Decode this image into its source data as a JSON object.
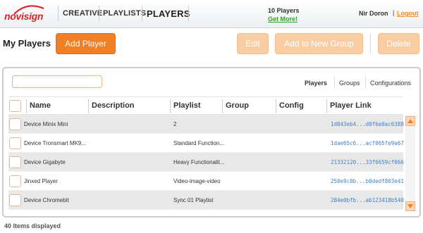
{
  "brand": {
    "logo_text": "novisign",
    "accent": "#f07f26",
    "logo_color": "#d8232a"
  },
  "nav": {
    "creative": "CREATIVE",
    "playlists": "PLAYLISTS",
    "players": "PLAYERS"
  },
  "account": {
    "players_count": "10 Players",
    "get_more": "Get More!",
    "user_name": "Nir Doron",
    "separator": "|",
    "logout": "Logout"
  },
  "actions": {
    "title": "My Players",
    "add_player": "Add Player",
    "edit": "Edit",
    "add_to_group": "Add to New Group",
    "delete": "Delete"
  },
  "search": {
    "placeholder": "",
    "value": ""
  },
  "subtabs": {
    "players": "Players",
    "groups": "Groups",
    "configurations": "Configurations"
  },
  "table": {
    "headers": {
      "name": "Name",
      "description": "Description",
      "playlist": "Playlist",
      "group": "Group",
      "config": "Config",
      "player_link": "Player Link"
    },
    "rows": [
      {
        "name": "Device Minix Mini",
        "description": "",
        "playlist": "2",
        "group": "",
        "config": "",
        "player_link": "1d843eb4...d0f6e0ac6388"
      },
      {
        "name": "Device Tronsmart MK9...",
        "description": "",
        "playlist": "Standard Function...",
        "group": "",
        "config": "",
        "player_link": "1dae65c6...acf065fe9a67"
      },
      {
        "name": "Device Gigabyte",
        "description": "",
        "playlist": "Heavy Functionalit...",
        "group": "",
        "config": "",
        "player_link": "21332120...33f6659cf066"
      },
      {
        "name": "Jinxed Player",
        "description": "",
        "playlist": "Video-image-video",
        "group": "",
        "config": "",
        "player_link": "250e9c0b...b0dedf803e41"
      },
      {
        "name": "Device Chromebit",
        "description": "",
        "playlist": "Sync 01 Playlist",
        "group": "",
        "config": "",
        "player_link": "284e0bfb...ab123418b540"
      }
    ]
  },
  "footer": {
    "items_displayed": "40 Items displayed"
  }
}
